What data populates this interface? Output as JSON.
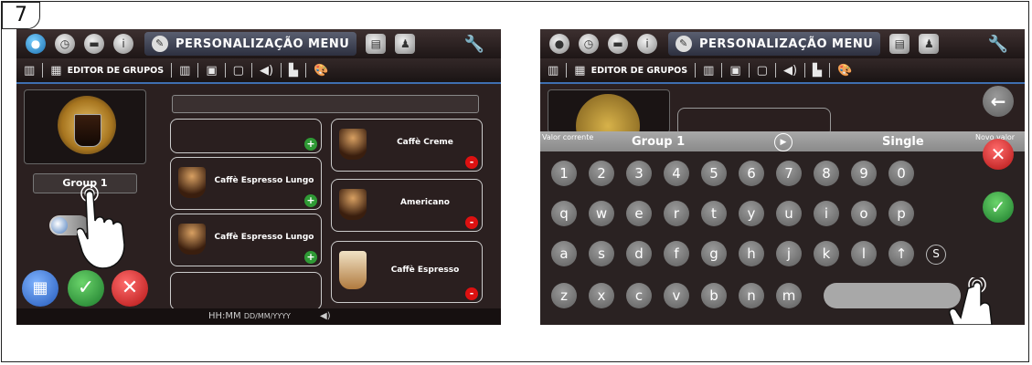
{
  "step": "7",
  "left_screen": {
    "menu_title": "PERSONALIZAÇÃO MENU",
    "editor_label": "EDITOR DE GRUPOS",
    "group_name": "Group 1",
    "status_time": "HH:MM",
    "status_date": "DD/MM/YYYY",
    "drinks_left": [
      {
        "label": "Caffè Espresso Lungo",
        "badge": "+"
      },
      {
        "label": "Caffè Espresso Lungo",
        "badge": "+"
      }
    ],
    "drinks_right": [
      {
        "label": "Caffè Creme",
        "badge": "-"
      },
      {
        "label": "Americano",
        "badge": "-"
      },
      {
        "label": "Caffè Espresso",
        "badge": "-"
      }
    ],
    "top_badge": "+"
  },
  "right_screen": {
    "menu_title": "PERSONALIZAÇÃO MENU",
    "editor_label": "EDITOR DE GRUPOS",
    "current_value_label": "Valor corrente",
    "current_value": "Group 1",
    "new_value_label": "Novo valor",
    "new_value": "Single",
    "keys_row1": [
      "1",
      "2",
      "3",
      "4",
      "5",
      "6",
      "7",
      "8",
      "9",
      "0"
    ],
    "keys_row2": [
      "q",
      "w",
      "e",
      "r",
      "t",
      "y",
      "u",
      "i",
      "o",
      "p"
    ],
    "keys_row3": [
      "a",
      "s",
      "d",
      "f",
      "g",
      "h",
      "j",
      "k",
      "l",
      "↑",
      "S"
    ],
    "keys_row4": [
      "z",
      "x",
      "c",
      "v",
      "b",
      "n",
      "m"
    ]
  }
}
